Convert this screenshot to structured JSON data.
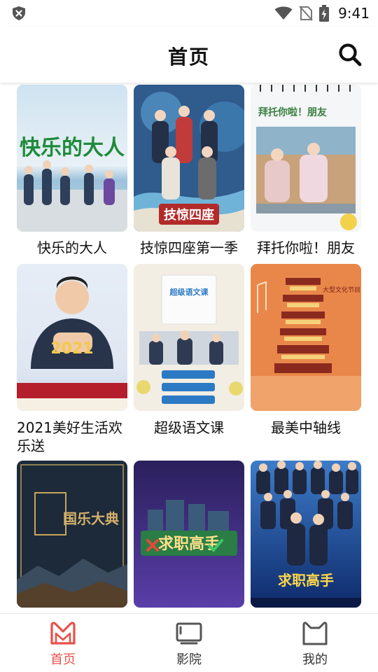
{
  "status_bar": {
    "time": "9:41",
    "icons": [
      "shield-icon",
      "wifi-icon",
      "no-sim-icon",
      "battery-icon"
    ]
  },
  "header": {
    "title": "首页",
    "search_icon": "search-icon"
  },
  "programs": [
    {
      "title": "快乐的大人",
      "poster_text": "快乐的大人"
    },
    {
      "title": "技惊四座第一季",
      "poster_text": "技惊四座"
    },
    {
      "title": "拜托你啦！朋友",
      "poster_text": "拜托你啦！朋友"
    },
    {
      "title": "2021美好生活欢乐送",
      "poster_text": "2021"
    },
    {
      "title": "超级语文课",
      "poster_text": "超级语文课"
    },
    {
      "title": "最美中轴线",
      "poster_text": "大型文化节目"
    },
    {
      "title": "",
      "poster_text": "国乐大典"
    },
    {
      "title": "",
      "poster_text": "求职高手"
    },
    {
      "title": "",
      "poster_text": "求职高手"
    }
  ],
  "bottom_nav": {
    "items": [
      {
        "label": "首页",
        "icon": "home-m-icon",
        "active": true
      },
      {
        "label": "影院",
        "icon": "tv-icon",
        "active": false
      },
      {
        "label": "我的",
        "icon": "cat-profile-icon",
        "active": false
      }
    ]
  },
  "colors": {
    "accent": "#e8524a",
    "text": "#111111",
    "nav_inactive": "#555555"
  }
}
